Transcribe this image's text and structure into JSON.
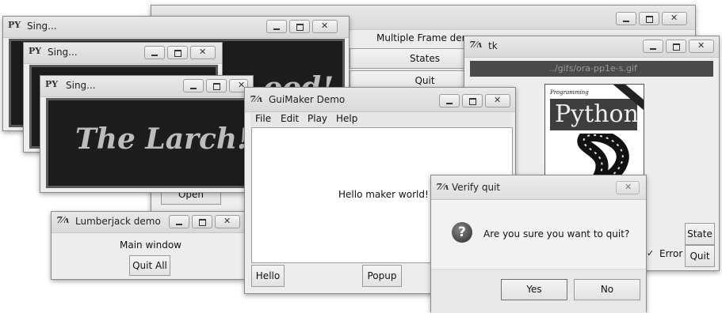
{
  "back_window": {
    "menu_title": "Multiple Frame demo",
    "states_button": "States",
    "quit_button": "Quit",
    "open_button": "Open"
  },
  "sing_windows": [
    {
      "title": "Sing...",
      "text": "ood!"
    },
    {
      "title": "Sing..."
    },
    {
      "title": "Sing...",
      "text": "The Larch!"
    }
  ],
  "lumberjack": {
    "title": "Lumberjack demo",
    "main_label": "Main window",
    "quit_all_button": "Quit All"
  },
  "tk_window": {
    "title": "tk",
    "path": "../gifs/ora-pp1e-s.gif",
    "book_small_text": "Programming",
    "book_title": "Python",
    "state_button": "State",
    "quit_button": "Quit",
    "error_label": "Error",
    "error_checked": true
  },
  "guimaker": {
    "title": "GuiMaker Demo",
    "menu": [
      "File",
      "Edit",
      "Play",
      "Help"
    ],
    "message": "Hello maker world!",
    "hello_button": "Hello",
    "popup_button": "Popup"
  },
  "verify_dialog": {
    "title": "Verify quit",
    "message": "Are you sure you want to quit?",
    "yes_button": "Yes",
    "no_button": "No"
  },
  "icons": {
    "app_icon": "tk-feather-icon",
    "py_icon": "python-icon",
    "question": "question-icon"
  }
}
